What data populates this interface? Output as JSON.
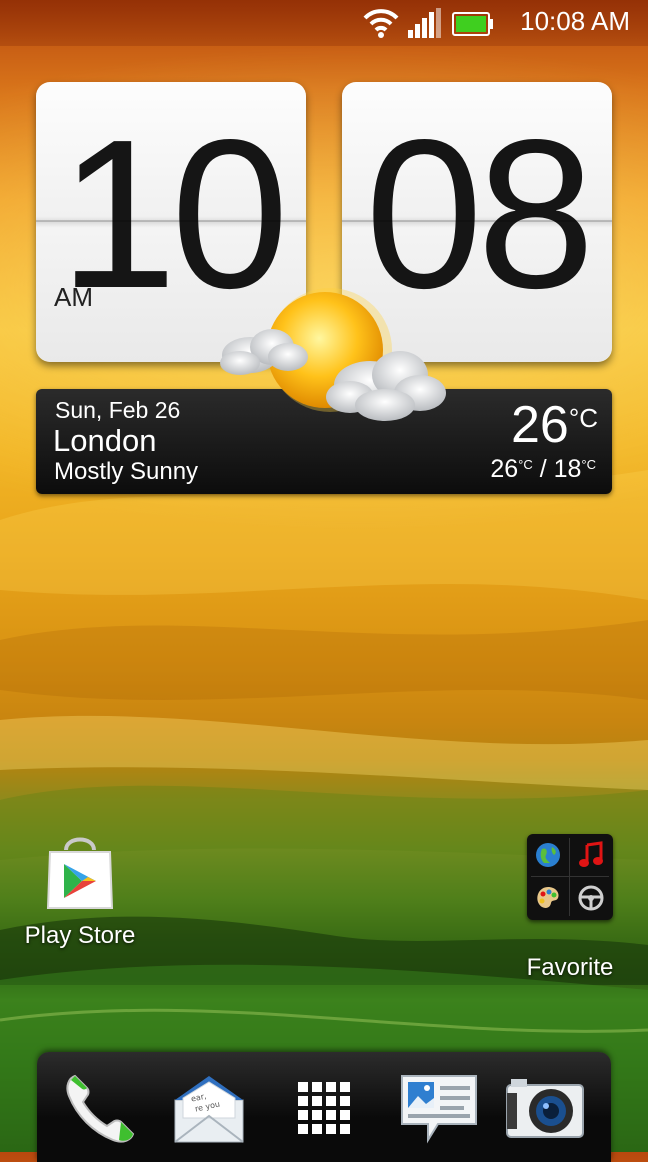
{
  "status_bar": {
    "time": "10:08 AM",
    "icons": [
      "wifi-icon",
      "signal-icon",
      "battery-icon"
    ]
  },
  "clock": {
    "hour": "10",
    "minute": "08",
    "ampm": "AM"
  },
  "weather": {
    "date": "Sun, Feb 26",
    "city": "London",
    "condition": "Mostly Sunny",
    "temperature": "26",
    "unit": "°C",
    "high": "26",
    "low": "18",
    "range_unit": "°C",
    "icon": "sun-with-clouds-icon"
  },
  "home_apps": [
    {
      "label": "Play Store",
      "icon": "play-store-icon"
    },
    {
      "label": "Favorite",
      "icon": "favorite-folder-icon"
    }
  ],
  "dock": [
    {
      "icon": "phone-icon"
    },
    {
      "icon": "mail-icon"
    },
    {
      "icon": "app-drawer-icon"
    },
    {
      "icon": "messages-icon"
    },
    {
      "icon": "camera-icon"
    }
  ],
  "colors": {
    "battery_green": "#3fcf1f",
    "play_green": "#2fb34a",
    "music_red": "#e01414"
  }
}
